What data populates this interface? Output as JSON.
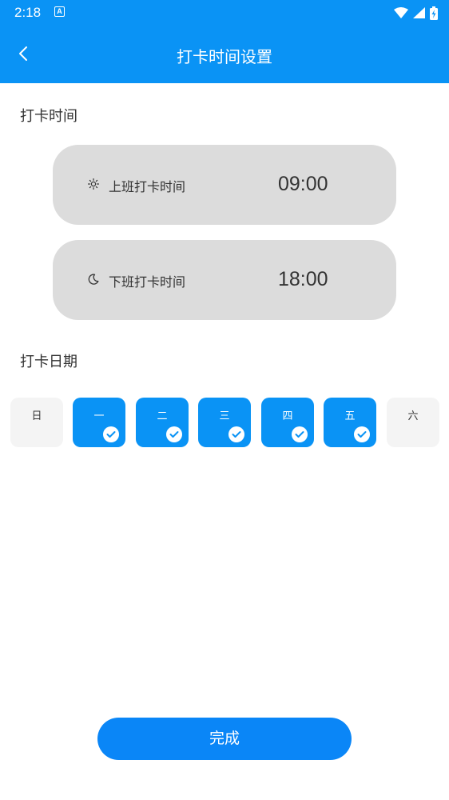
{
  "status_bar": {
    "time": "2:18",
    "a_badge": "A",
    "icons": [
      "wifi-icon",
      "signal-icon",
      "battery-charging-icon"
    ]
  },
  "header": {
    "title": "打卡时间设置",
    "back_icon": "chevron-left-icon"
  },
  "time_section": {
    "label": "打卡时间",
    "items": [
      {
        "icon": "sun-icon",
        "label": "上班打卡时间",
        "time": "09:00"
      },
      {
        "icon": "moon-icon",
        "label": "下班打卡时间",
        "time": "18:00"
      }
    ]
  },
  "date_section": {
    "label": "打卡日期",
    "days": [
      {
        "label": "日",
        "selected": false
      },
      {
        "label": "一",
        "selected": true
      },
      {
        "label": "二",
        "selected": true
      },
      {
        "label": "三",
        "selected": true
      },
      {
        "label": "四",
        "selected": true
      },
      {
        "label": "五",
        "selected": true
      },
      {
        "label": "六",
        "selected": false
      }
    ]
  },
  "done_button": {
    "label": "完成"
  },
  "colors": {
    "primary": "#0a93f5",
    "button": "#0a86f7",
    "card": "#dcdcdc",
    "day_unselected": "#f4f4f4"
  }
}
